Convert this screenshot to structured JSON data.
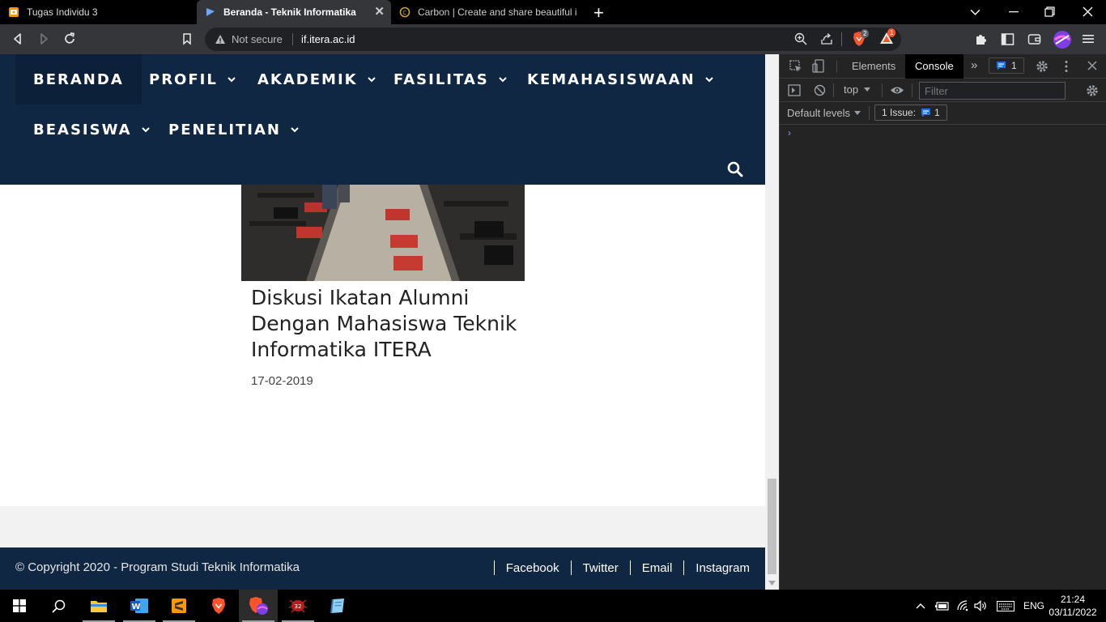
{
  "browser": {
    "tabs": [
      {
        "title": "Tugas Individu 3",
        "active": false
      },
      {
        "title": "Beranda - Teknik Informatika",
        "active": true
      },
      {
        "title": "Carbon | Create and share beautiful images",
        "active": false
      }
    ],
    "security_label": "Not secure",
    "url": "if.itera.ac.id",
    "brave_shield_count": "2",
    "rewards_count": "1"
  },
  "site": {
    "nav": [
      {
        "label": "BERANDA",
        "has_dropdown": false
      },
      {
        "label": "PROFIL",
        "has_dropdown": true
      },
      {
        "label": "AKADEMIK",
        "has_dropdown": true
      },
      {
        "label": "FASILITAS",
        "has_dropdown": true
      },
      {
        "label": "KEMAHASISWAAN",
        "has_dropdown": true
      },
      {
        "label": "BEASISWA",
        "has_dropdown": true
      },
      {
        "label": "PENELITIAN",
        "has_dropdown": true
      }
    ],
    "post": {
      "title": "Diskusi Ikatan Alumni Dengan Mahasiswa Teknik Informatika ITERA",
      "date": "17-02-2019"
    },
    "footer": {
      "copyright": "© Copyright 2020 - Program Studi Teknik Informatika",
      "links": [
        "Facebook",
        "Twitter",
        "Email",
        "Instagram"
      ]
    }
  },
  "devtools": {
    "tabs": [
      "Elements",
      "Console"
    ],
    "active_tab": "Console",
    "issues_badge": "1",
    "context": "top",
    "filter_placeholder": "Filter",
    "levels": "Default levels",
    "issue_label": "1 Issue:",
    "issue_count": "1",
    "prompt": "›"
  },
  "taskbar": {
    "language": "ENG",
    "time": "21:24",
    "date": "03/11/2022"
  },
  "colors": {
    "site_navy": "#0f2742",
    "devtools_bg": "#242424",
    "accent_blue": "#1a73e8",
    "brave_orange": "#fb542b"
  }
}
